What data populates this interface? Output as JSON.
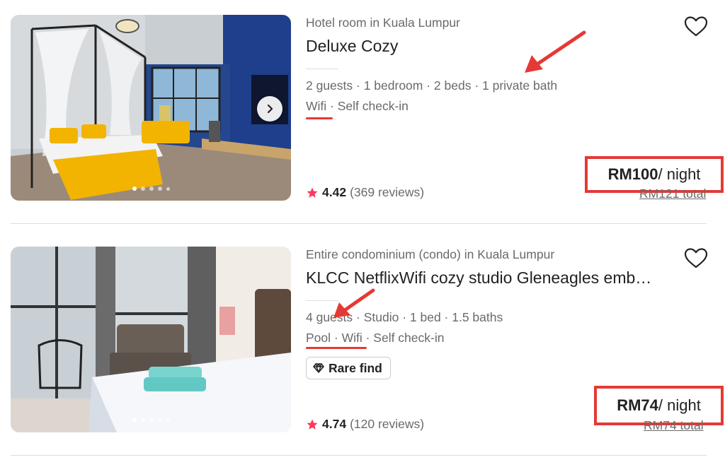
{
  "listings": [
    {
      "subtitle": "Hotel room in Kuala Lumpur",
      "title": "Deluxe Cozy",
      "details": "2 guests · 1 bedroom · 2 beds · 1 private bath",
      "amenities": {
        "a": "Wifi",
        "b": " · Self check-in"
      },
      "rating": "4.42",
      "reviews": "(369 reviews)",
      "price": "RM100",
      "per_night": " / night",
      "total": "RM121 total",
      "photo_count": 5
    },
    {
      "subtitle": "Entire condominium (condo) in Kuala Lumpur",
      "title": "KLCC NetflixWifi cozy studio Gleneagles emb…",
      "details": "4 guests · Studio · 1 bed · 1.5 baths",
      "amenities": {
        "a": "Pool · Wifi",
        "b": " · Self check-in"
      },
      "badge": "Rare find",
      "rating": "4.74",
      "reviews": "(120 reviews)",
      "price": "RM74",
      "per_night": " / night",
      "total": "RM74 total",
      "photo_count": 5
    }
  ],
  "icons": {
    "favorite": "heart-outline-icon",
    "next": "chevron-right-icon",
    "star": "star-icon",
    "badge": "diamond-icon"
  },
  "colors": {
    "annotation_red": "#e53935",
    "star": "#ff385c",
    "text_secondary": "#6a6a6a"
  }
}
